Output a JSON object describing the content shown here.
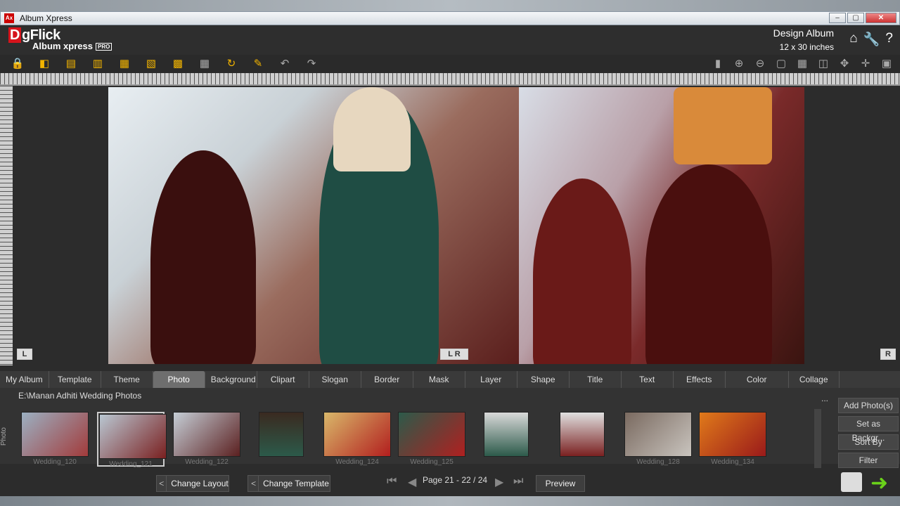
{
  "window": {
    "title": "Album Xpress",
    "icon_text": "Ax",
    "min": "–",
    "max": "▢",
    "close": "✕"
  },
  "logo": {
    "brand": "DgFlick",
    "product": "Album xpress",
    "badge": "PRO"
  },
  "header": {
    "mode": "Design Album",
    "size": "12 x 30 inches",
    "icons": [
      "home-icon",
      "wrench-icon",
      "help-icon"
    ]
  },
  "toolbar": {
    "icons": [
      "lock-icon",
      "bring-forward-icon",
      "align-icon",
      "send-backward-icon",
      "distribute-icon",
      "flip-icon",
      "grid-icon",
      "layout-icon",
      "rotate-icon",
      "edit-icon",
      "undo-icon",
      "redo-icon"
    ]
  },
  "view_tools": {
    "icons": [
      "fit-icon",
      "zoom-in-icon",
      "zoom-out-icon",
      "grid1-icon",
      "grid2-icon",
      "split-icon",
      "expand-icon",
      "move-icon",
      "fullscreen-icon"
    ]
  },
  "spread": {
    "left_tag": "L",
    "right_tag": "R",
    "center_tag": "L R"
  },
  "tabs": [
    "My Album",
    "Template",
    "Theme",
    "Photo",
    "Background",
    "Clipart",
    "Slogan",
    "Border",
    "Mask",
    "Layer Mask",
    "Shape",
    "Title",
    "Text",
    "Effects",
    "Color correction",
    "Collage"
  ],
  "active_tab": "Photo",
  "photo_panel": {
    "path": "E:\\Manan Adhiti Wedding Photos",
    "side_label": "Photo",
    "more": "...",
    "thumbnails": [
      "Wedding_120",
      "Wedding_121",
      "Wedding_122",
      "",
      "Wedding_124",
      "Wedding_125",
      "",
      "",
      "Wedding_128",
      "Wedding_134"
    ],
    "selected_index": 1,
    "buttons": [
      "Add Photo(s)",
      "Set as Backgr...",
      "Sort By",
      "Filter"
    ]
  },
  "bottom": {
    "change_layout": "Change Layout",
    "change_template": "Change Template",
    "page_info": "Page 21 - 22 / 24",
    "preview": "Preview",
    "back": "<"
  },
  "colors": {
    "accent": "#f2b400",
    "brand_red": "#d6141c",
    "panel": "#333333",
    "active_tab": "#6e6e6e"
  }
}
